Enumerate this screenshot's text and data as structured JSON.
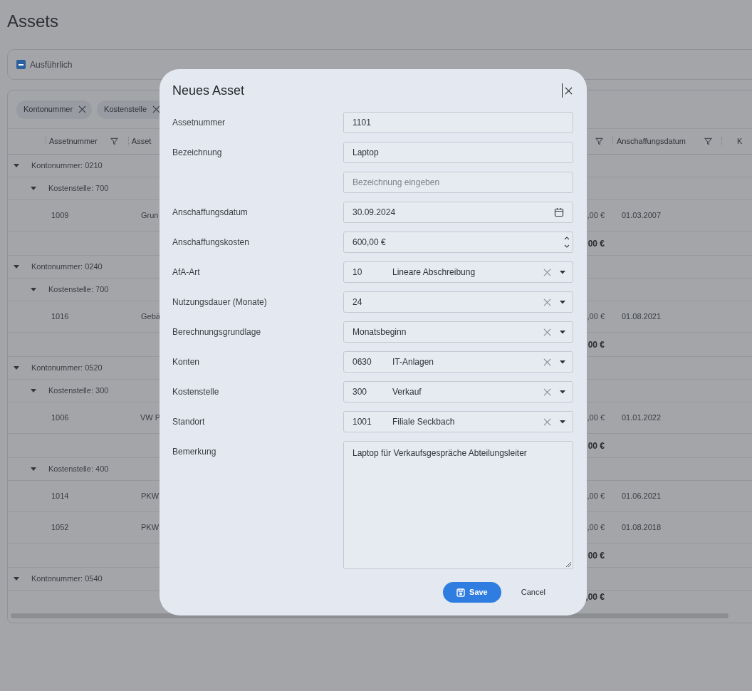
{
  "page": {
    "title": "Assets"
  },
  "toolbar": {
    "toggle": {
      "label": "Ausführlich",
      "indeterminate": true
    }
  },
  "group_chips": [
    {
      "label": "Kontonummer"
    },
    {
      "label": "Kostenstelle"
    }
  ],
  "grid": {
    "columns": [
      {
        "label": "Assetnummer"
      },
      {
        "label": "Asset"
      },
      {
        "label": "Anschaffungsdatum"
      },
      {
        "label": "K"
      }
    ],
    "groups": [
      {
        "label": "Kontonummer: 0210",
        "expanded": true,
        "children": [
          {
            "label": "Kostenstelle: 700",
            "expanded": true,
            "rows": [
              {
                "asset": "1009",
                "name": "Grun",
                "amount": ",00 €",
                "date": "01.03.2007"
              }
            ],
            "total": "00 €"
          }
        ]
      },
      {
        "label": "Kontonummer: 0240",
        "expanded": true,
        "children": [
          {
            "label": "Kostenstelle: 700",
            "expanded": true,
            "rows": [
              {
                "asset": "1016",
                "name": "Gebä",
                "amount": ",00 €",
                "date": "01.08.2021"
              }
            ],
            "total": "00 €"
          }
        ]
      },
      {
        "label": "Kontonummer: 0520",
        "expanded": true,
        "children": [
          {
            "label": "Kostenstelle: 300",
            "expanded": true,
            "rows": [
              {
                "asset": "1006",
                "name": "VW P",
                "amount": ",00 €",
                "date": "01.01.2022"
              }
            ],
            "total": "00 €"
          },
          {
            "label": "Kostenstelle: 400",
            "expanded": true,
            "rows": [
              {
                "asset": "1014",
                "name": "PKW",
                "amount": ",00 €",
                "date": "01.06.2021"
              },
              {
                "asset": "1052",
                "name": "PKW",
                "amount": ",00 €",
                "date": "01.08.2018"
              }
            ],
            "total": "00 €"
          }
        ]
      },
      {
        "label": "Kontonummer: 0540",
        "expanded": true,
        "total": ",00 €"
      }
    ]
  },
  "dialog": {
    "title": "Neues Asset",
    "fields": [
      {
        "kind": "text",
        "label": "Assetnummer",
        "value": "1101"
      },
      {
        "kind": "text",
        "label": "Bezeichnung",
        "value": "Laptop"
      },
      {
        "kind": "text",
        "placeholder": "Bezeichnung eingeben"
      },
      {
        "kind": "date",
        "label": "Anschaffungsdatum",
        "value": "30.09.2024"
      },
      {
        "kind": "number",
        "label": "Anschaffungskosten",
        "value": "600,00 €"
      },
      {
        "kind": "select",
        "label": "AfA-Art",
        "code": "10",
        "value": "Lineare Abschreibung"
      },
      {
        "kind": "select",
        "label": "Nutzungsdauer (Monate)",
        "value": "24"
      },
      {
        "kind": "select",
        "label": "Berechnungsgrundlage",
        "value": "Monatsbeginn"
      },
      {
        "kind": "select",
        "label": "Konten",
        "code": "0630",
        "value": "IT-Anlagen"
      },
      {
        "kind": "select",
        "label": "Kostenstelle",
        "code": "300",
        "value": "Verkauf"
      },
      {
        "kind": "select",
        "label": "Standort",
        "code": "1001",
        "value": "Filiale Seckbach"
      },
      {
        "kind": "textarea",
        "label": "Bemerkung",
        "value": "Laptop für Verkaufsgespräche Abteilungsleiter"
      }
    ],
    "buttons": [
      {
        "kind": "primary",
        "label": "Save"
      },
      {
        "kind": "secondary",
        "label": "Cancel"
      }
    ]
  }
}
